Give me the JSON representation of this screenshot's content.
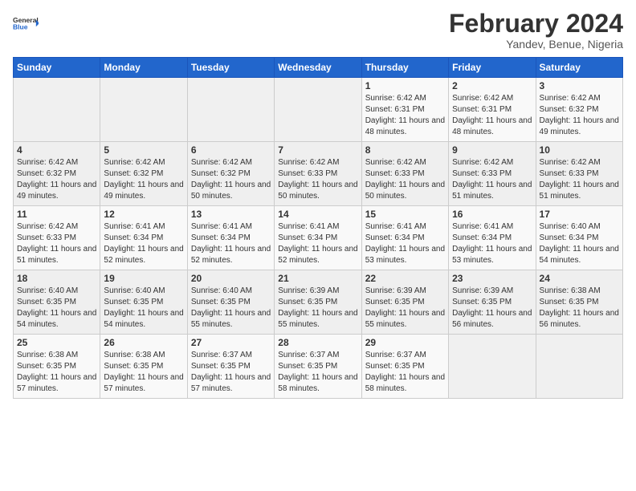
{
  "header": {
    "logo_line1": "General",
    "logo_line2": "Blue",
    "title": "February 2024",
    "subtitle": "Yandev, Benue, Nigeria"
  },
  "days_of_week": [
    "Sunday",
    "Monday",
    "Tuesday",
    "Wednesday",
    "Thursday",
    "Friday",
    "Saturday"
  ],
  "weeks": [
    [
      {
        "day": "",
        "info": ""
      },
      {
        "day": "",
        "info": ""
      },
      {
        "day": "",
        "info": ""
      },
      {
        "day": "",
        "info": ""
      },
      {
        "day": "1",
        "info": "Sunrise: 6:42 AM\nSunset: 6:31 PM\nDaylight: 11 hours and 48 minutes."
      },
      {
        "day": "2",
        "info": "Sunrise: 6:42 AM\nSunset: 6:31 PM\nDaylight: 11 hours and 48 minutes."
      },
      {
        "day": "3",
        "info": "Sunrise: 6:42 AM\nSunset: 6:32 PM\nDaylight: 11 hours and 49 minutes."
      }
    ],
    [
      {
        "day": "4",
        "info": "Sunrise: 6:42 AM\nSunset: 6:32 PM\nDaylight: 11 hours and 49 minutes."
      },
      {
        "day": "5",
        "info": "Sunrise: 6:42 AM\nSunset: 6:32 PM\nDaylight: 11 hours and 49 minutes."
      },
      {
        "day": "6",
        "info": "Sunrise: 6:42 AM\nSunset: 6:32 PM\nDaylight: 11 hours and 50 minutes."
      },
      {
        "day": "7",
        "info": "Sunrise: 6:42 AM\nSunset: 6:33 PM\nDaylight: 11 hours and 50 minutes."
      },
      {
        "day": "8",
        "info": "Sunrise: 6:42 AM\nSunset: 6:33 PM\nDaylight: 11 hours and 50 minutes."
      },
      {
        "day": "9",
        "info": "Sunrise: 6:42 AM\nSunset: 6:33 PM\nDaylight: 11 hours and 51 minutes."
      },
      {
        "day": "10",
        "info": "Sunrise: 6:42 AM\nSunset: 6:33 PM\nDaylight: 11 hours and 51 minutes."
      }
    ],
    [
      {
        "day": "11",
        "info": "Sunrise: 6:42 AM\nSunset: 6:33 PM\nDaylight: 11 hours and 51 minutes."
      },
      {
        "day": "12",
        "info": "Sunrise: 6:41 AM\nSunset: 6:34 PM\nDaylight: 11 hours and 52 minutes."
      },
      {
        "day": "13",
        "info": "Sunrise: 6:41 AM\nSunset: 6:34 PM\nDaylight: 11 hours and 52 minutes."
      },
      {
        "day": "14",
        "info": "Sunrise: 6:41 AM\nSunset: 6:34 PM\nDaylight: 11 hours and 52 minutes."
      },
      {
        "day": "15",
        "info": "Sunrise: 6:41 AM\nSunset: 6:34 PM\nDaylight: 11 hours and 53 minutes."
      },
      {
        "day": "16",
        "info": "Sunrise: 6:41 AM\nSunset: 6:34 PM\nDaylight: 11 hours and 53 minutes."
      },
      {
        "day": "17",
        "info": "Sunrise: 6:40 AM\nSunset: 6:34 PM\nDaylight: 11 hours and 54 minutes."
      }
    ],
    [
      {
        "day": "18",
        "info": "Sunrise: 6:40 AM\nSunset: 6:35 PM\nDaylight: 11 hours and 54 minutes."
      },
      {
        "day": "19",
        "info": "Sunrise: 6:40 AM\nSunset: 6:35 PM\nDaylight: 11 hours and 54 minutes."
      },
      {
        "day": "20",
        "info": "Sunrise: 6:40 AM\nSunset: 6:35 PM\nDaylight: 11 hours and 55 minutes."
      },
      {
        "day": "21",
        "info": "Sunrise: 6:39 AM\nSunset: 6:35 PM\nDaylight: 11 hours and 55 minutes."
      },
      {
        "day": "22",
        "info": "Sunrise: 6:39 AM\nSunset: 6:35 PM\nDaylight: 11 hours and 55 minutes."
      },
      {
        "day": "23",
        "info": "Sunrise: 6:39 AM\nSunset: 6:35 PM\nDaylight: 11 hours and 56 minutes."
      },
      {
        "day": "24",
        "info": "Sunrise: 6:38 AM\nSunset: 6:35 PM\nDaylight: 11 hours and 56 minutes."
      }
    ],
    [
      {
        "day": "25",
        "info": "Sunrise: 6:38 AM\nSunset: 6:35 PM\nDaylight: 11 hours and 57 minutes."
      },
      {
        "day": "26",
        "info": "Sunrise: 6:38 AM\nSunset: 6:35 PM\nDaylight: 11 hours and 57 minutes."
      },
      {
        "day": "27",
        "info": "Sunrise: 6:37 AM\nSunset: 6:35 PM\nDaylight: 11 hours and 57 minutes."
      },
      {
        "day": "28",
        "info": "Sunrise: 6:37 AM\nSunset: 6:35 PM\nDaylight: 11 hours and 58 minutes."
      },
      {
        "day": "29",
        "info": "Sunrise: 6:37 AM\nSunset: 6:35 PM\nDaylight: 11 hours and 58 minutes."
      },
      {
        "day": "",
        "info": ""
      },
      {
        "day": "",
        "info": ""
      }
    ]
  ]
}
